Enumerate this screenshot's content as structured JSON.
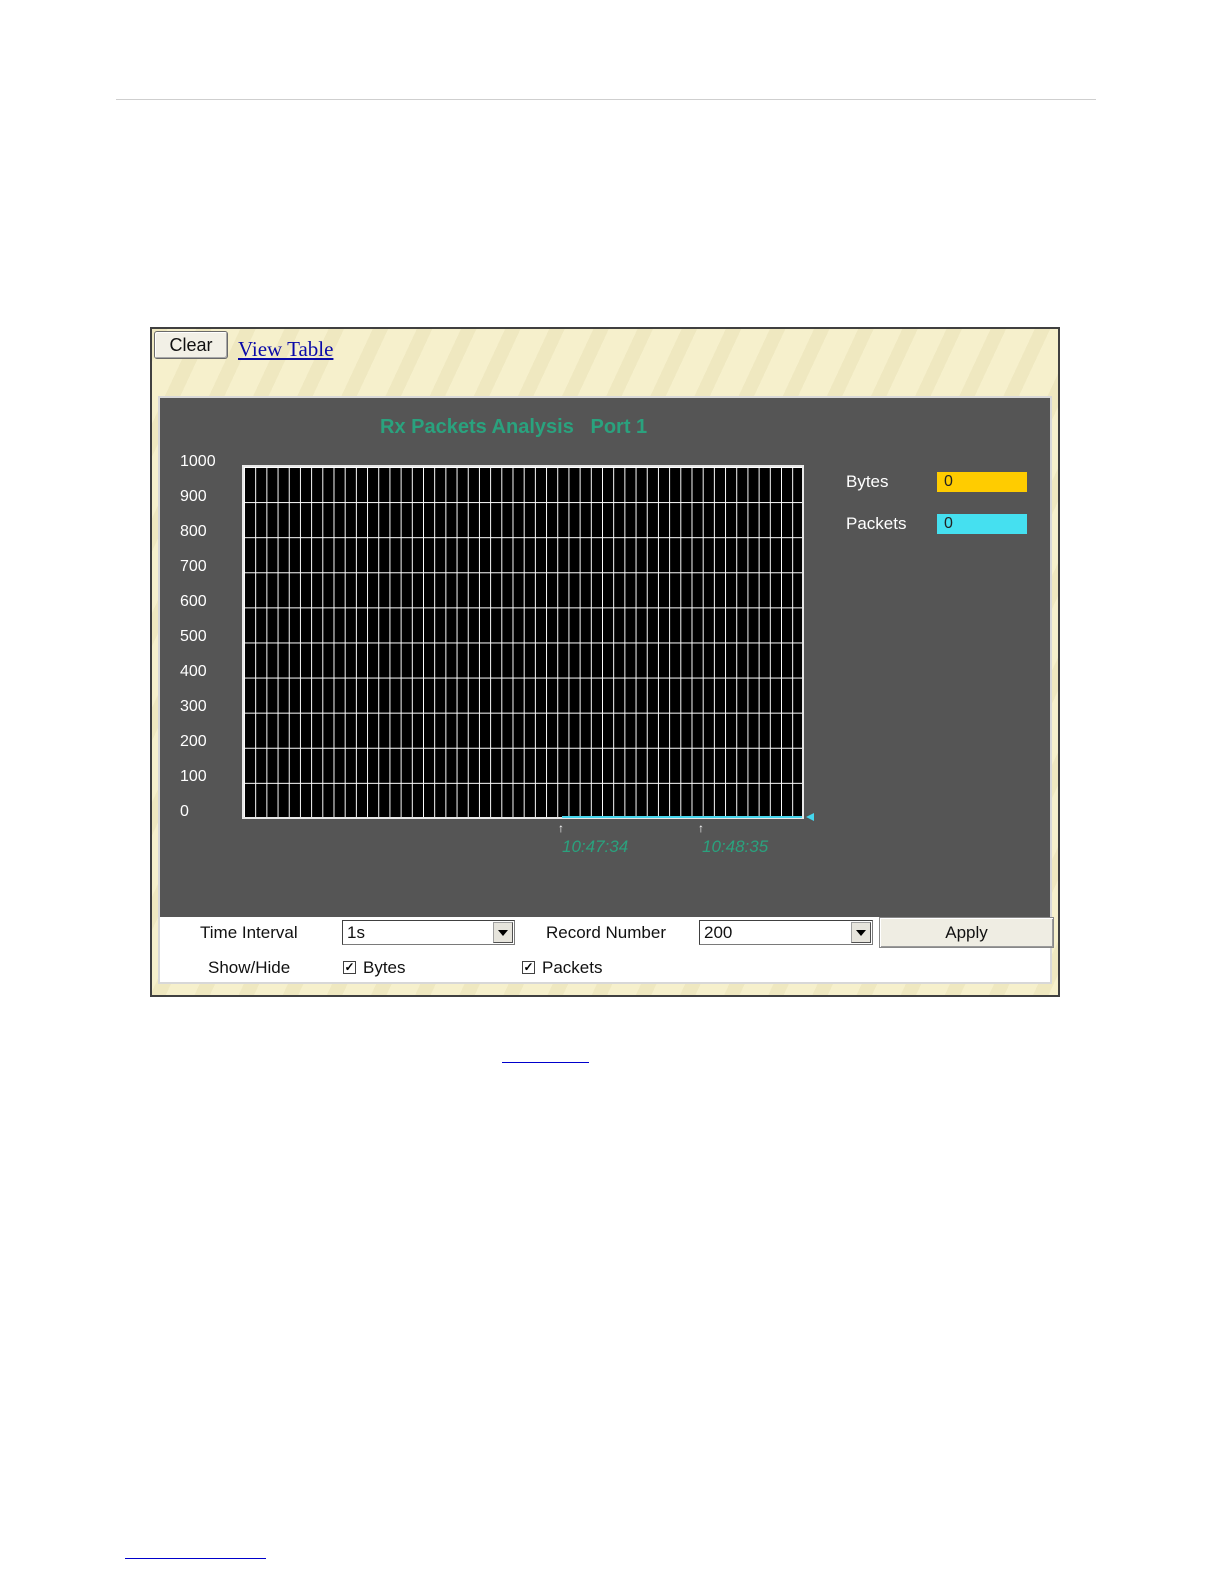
{
  "toolbar": {
    "clear_label": "Clear",
    "view_table_label": "View Table"
  },
  "graph": {
    "title": "Rx Packets Analysis   Port 1",
    "yticks": [
      "1000",
      "900",
      "800",
      "700",
      "600",
      "500",
      "400",
      "300",
      "200",
      "100",
      "0"
    ],
    "time_labels": [
      "10:47:34",
      "10:48:35"
    ],
    "legend": [
      {
        "label": "Bytes",
        "value": "0",
        "color": "#ffcc00"
      },
      {
        "label": "Packets",
        "value": "0",
        "color": "#45e0f0"
      }
    ]
  },
  "chart_data": {
    "type": "line",
    "title": "Rx Packets Analysis   Port 1",
    "ylim": [
      0,
      1000
    ],
    "x": [
      "10:47:34",
      "10:48:35"
    ],
    "series": [
      {
        "name": "Bytes",
        "values": [
          0,
          0
        ],
        "color": "#ffcc00"
      },
      {
        "name": "Packets",
        "values": [
          0,
          0
        ],
        "color": "#45e0f0"
      }
    ],
    "grid": true,
    "legend": "right"
  },
  "controls": {
    "time_interval_label": "Time Interval",
    "time_interval_value": "1s",
    "record_number_label": "Record Number",
    "record_number_value": "200",
    "apply_label": "Apply",
    "showhide_label": "Show/Hide",
    "bytes_label": "Bytes",
    "packets_label": "Packets",
    "bytes_checked": true,
    "packets_checked": true
  }
}
